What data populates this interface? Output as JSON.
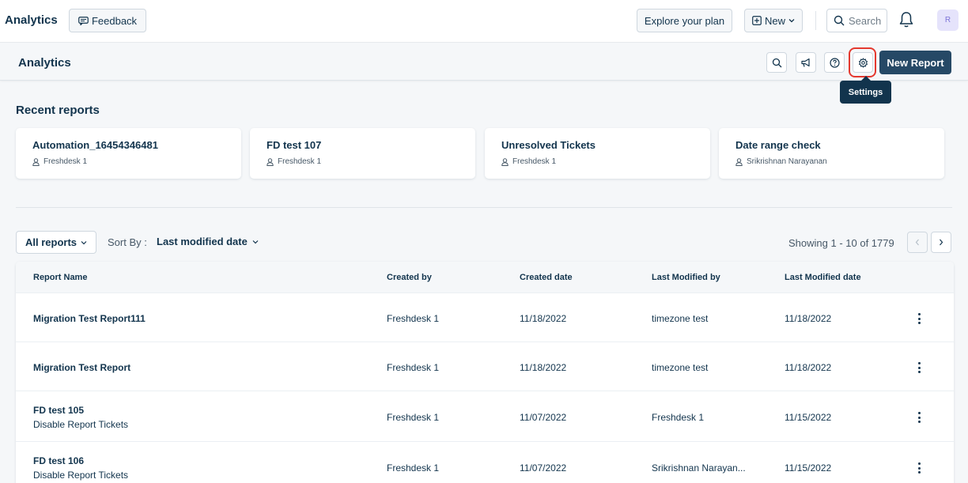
{
  "topbar": {
    "app_title": "Analytics",
    "feedback_label": "Feedback",
    "explore_label": "Explore your plan",
    "new_label": "New",
    "search_placeholder": "Search",
    "avatar_initial": "R"
  },
  "subheader": {
    "title": "Analytics",
    "new_report_label": "New Report",
    "tooltip": "Settings",
    "icons": [
      "search-icon",
      "megaphone-icon",
      "help-icon",
      "gear-icon"
    ]
  },
  "recent": {
    "title": "Recent reports",
    "cards": [
      {
        "title": "Automation_16454346481",
        "owner": "Freshdesk 1"
      },
      {
        "title": "FD test 107",
        "owner": "Freshdesk 1"
      },
      {
        "title": "Unresolved Tickets",
        "owner": "Freshdesk 1"
      },
      {
        "title": "Date range check",
        "owner": "Srikrishnan Narayanan"
      }
    ]
  },
  "filters": {
    "all_reports_label": "All reports",
    "sort_label": "Sort By :",
    "sort_value": "Last modified date",
    "showing": "Showing 1 - 10 of 1779"
  },
  "table": {
    "columns": [
      "Report Name",
      "Created by",
      "Created date",
      "Last Modified by",
      "Last Modified date"
    ],
    "rows": [
      {
        "name": "Migration Test Report111",
        "sub": "",
        "created_by": "Freshdesk 1",
        "created_date": "11/18/2022",
        "modified_by": "timezone test",
        "modified_date": "11/18/2022"
      },
      {
        "name": "Migration Test Report",
        "sub": "",
        "created_by": "Freshdesk 1",
        "created_date": "11/18/2022",
        "modified_by": "timezone test",
        "modified_date": "11/18/2022"
      },
      {
        "name": "FD test 105",
        "sub": "Disable Report Tickets",
        "created_by": "Freshdesk 1",
        "created_date": "11/07/2022",
        "modified_by": "Freshdesk 1",
        "modified_date": "11/15/2022"
      },
      {
        "name": "FD test 106",
        "sub": "Disable Report Tickets",
        "created_by": "Freshdesk 1",
        "created_date": "11/07/2022",
        "modified_by": "Srikrishnan Narayan...",
        "modified_date": "11/15/2022"
      }
    ]
  },
  "colors": {
    "primary": "#264966",
    "text": "#12344d",
    "highlight_ring": "#e4392f"
  }
}
